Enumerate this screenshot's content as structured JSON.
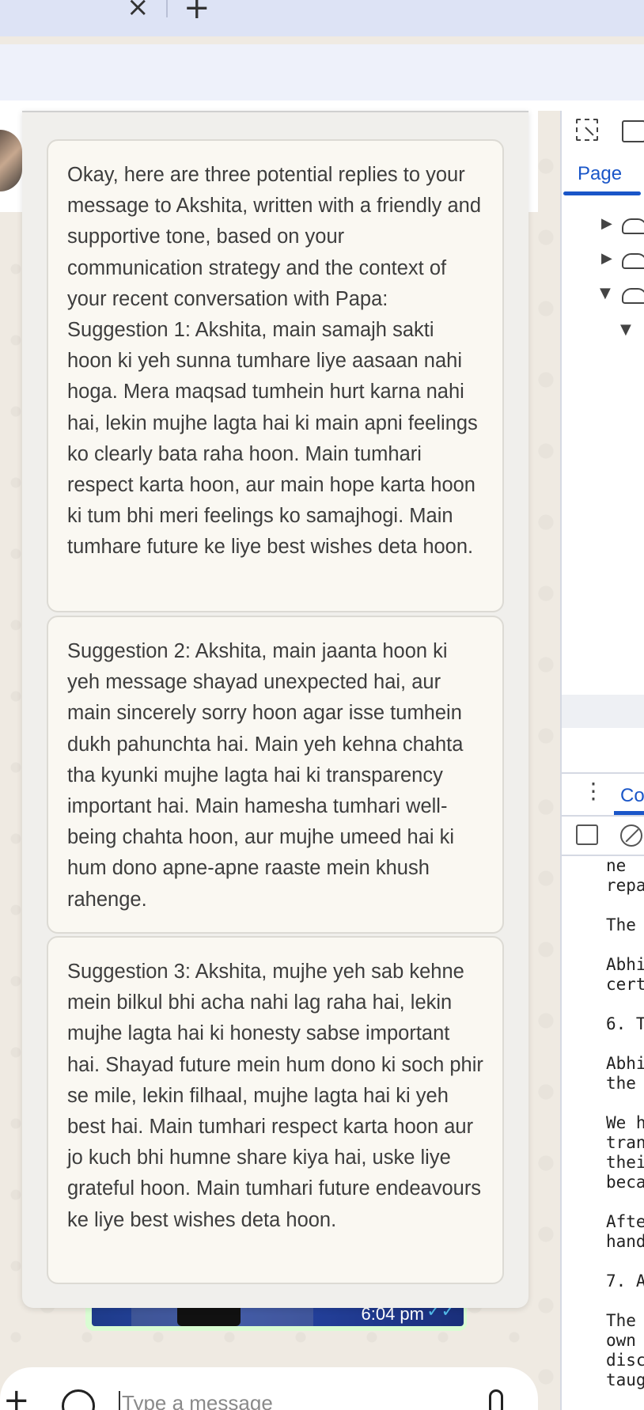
{
  "browser": {
    "close_tab_glyph": "×",
    "new_tab_glyph": "+"
  },
  "suggestions": {
    "items": [
      {
        "text": "Okay, here are three potential replies to your message to Akshita, written with a friendly and supportive tone, based on your communication strategy and the context of your recent conversation with Papa: Suggestion 1: Akshita, main samajh sakti hoon ki yeh sunna tumhare liye aasaan nahi hoga. Mera maqsad tumhein hurt karna nahi hai, lekin mujhe lagta hai ki main apni feelings ko clearly bata raha hoon. Main tumhari respect karta hoon, aur main hope karta hoon ki tum bhi meri feelings ko samajhogi. Main tumhare future ke liye best wishes deta hoon."
      },
      {
        "text": "Suggestion 2: Akshita, main jaanta hoon ki yeh message shayad unexpected hai, aur main sincerely sorry hoon agar isse tumhein dukh pahunchta hai. Main yeh kehna chahta tha kyunki mujhe lagta hai ki transparency important hai. Main hamesha tumhari well-being chahta hoon, aur mujhe umeed hai ki hum dono apne-apne raaste mein khush rahenge."
      },
      {
        "text": "Suggestion 3: Akshita, mujhe yeh sab kehne mein bilkul bhi acha nahi lag raha hai, lekin mujhe lagta hai ki honesty sabse important hai. Shayad future mein hum dono ki soch phir se mile, lekin filhaal, mujhe lagta hai ki yeh best hai. Main tumhari respect karta hoon aur jo kuch bhi humne share kiya hai, uske liye grateful hoon. Main tumhari future endeavours ke liye best wishes deta hoon."
      }
    ]
  },
  "chat": {
    "message_time": "6:04 pm",
    "composer_placeholder": "Type a message",
    "plus_glyph": "+"
  },
  "devtools": {
    "page_tab": "Page",
    "console_tab": "Co",
    "kebab_glyph": "⋮",
    "console_lines": "ne \nrepa\n\nThe \n\nAbhi\ncert\n\n6. T\n\nAbhi\nthe \n\nWe h\ntran\nthei\nbeca\n\nAfte\nhand\n\n7. A\n\nThe \nown \ndisc\ntaug"
  }
}
